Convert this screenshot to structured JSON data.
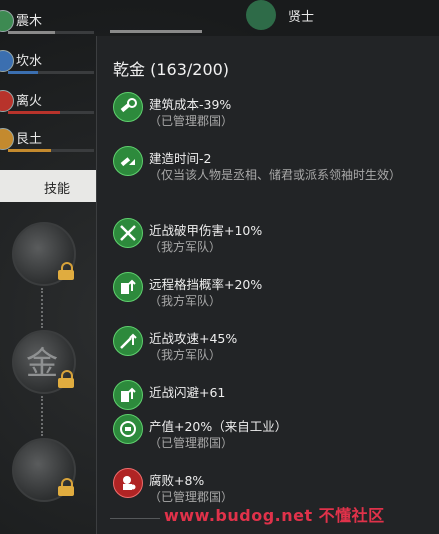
{
  "sidebar": {
    "elements": [
      {
        "label": "震木",
        "color": "#3d8a52",
        "bar_fill": 0.55,
        "bar_color": "#8a8a8a"
      },
      {
        "label": "坎水",
        "color": "#3b6fb0",
        "bar_fill": 0.35,
        "bar_color": "#3b6fb0"
      },
      {
        "label": "离火",
        "color": "#b8332b",
        "bar_fill": 0.6,
        "bar_color": "#b8332b"
      },
      {
        "label": "艮土",
        "color": "#c48a2e",
        "bar_fill": 0.5,
        "bar_color": "#c48a2e"
      }
    ],
    "skill_tab_label": "技能",
    "skill_nodes": [
      {
        "glyph": "",
        "locked": true
      },
      {
        "glyph": "金",
        "locked": true
      },
      {
        "glyph": "",
        "locked": true
      }
    ]
  },
  "background": {
    "title": "贤士"
  },
  "popup": {
    "title": "乾金 (163/200)",
    "effects": [
      {
        "icon": "build-cost-icon",
        "title": "建筑成本-39%",
        "sub": "（已管理郡国）",
        "color": "green"
      },
      {
        "icon": "build-time-icon",
        "title": "建造时间-2",
        "sub": "（仅当该人物是丞相、储君或派系领袖时生效）",
        "color": "green"
      },
      {
        "icon": "armor-pierce-icon",
        "title": "近战破甲伤害+10%",
        "sub": "（我方军队）",
        "color": "green"
      },
      {
        "icon": "ranged-block-icon",
        "title": "远程格挡概率+20%",
        "sub": "（我方军队）",
        "color": "green"
      },
      {
        "icon": "melee-speed-icon",
        "title": "近战攻速+45%",
        "sub": "（我方军队）",
        "color": "green"
      },
      {
        "icon": "melee-evade-icon",
        "title": "近战闪避+61",
        "sub": "",
        "color": "green"
      },
      {
        "icon": "output-icon",
        "title": "产值+20%（来自工业）",
        "sub": "（已管理郡国）",
        "color": "green"
      },
      {
        "icon": "corruption-icon",
        "title": "腐败+8%",
        "sub": "（已管理郡国）",
        "color": "red"
      }
    ]
  },
  "watermark": "www.budog.net 不懂社区"
}
